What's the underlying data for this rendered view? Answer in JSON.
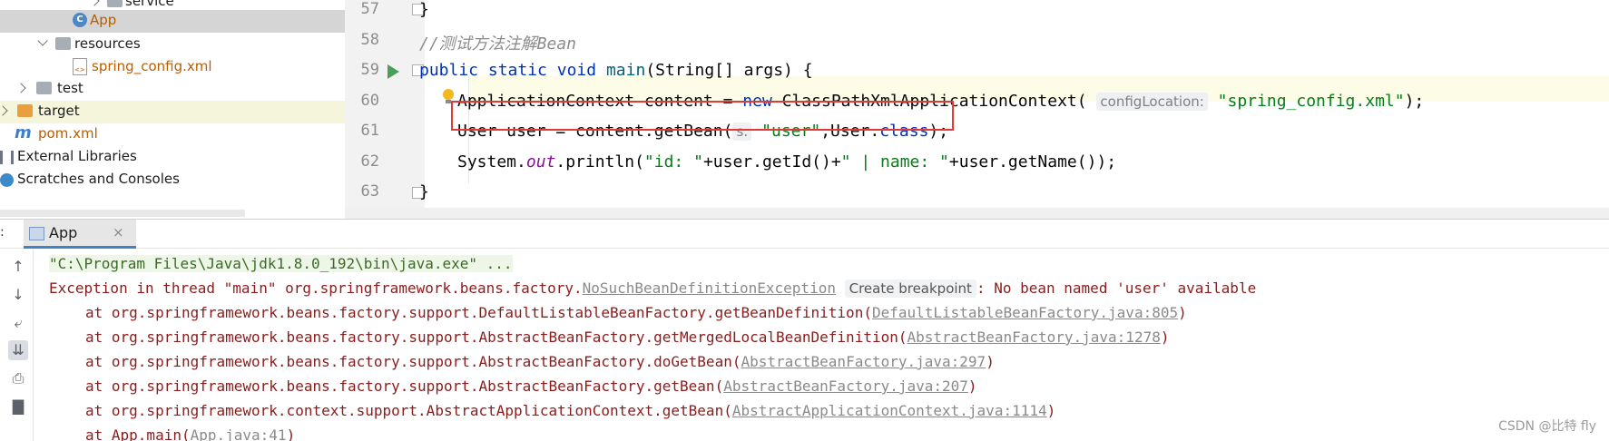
{
  "project_tree": {
    "items": [
      {
        "label": "service",
        "kind": "package"
      },
      {
        "label": "App",
        "kind": "class"
      },
      {
        "label": "resources",
        "kind": "folder"
      },
      {
        "label": "spring_config.xml",
        "kind": "xml"
      },
      {
        "label": "test",
        "kind": "folder"
      },
      {
        "label": "target",
        "kind": "folder"
      },
      {
        "label": "pom.xml",
        "kind": "maven"
      },
      {
        "label": "External Libraries",
        "kind": "libraries"
      },
      {
        "label": "Scratches and Consoles",
        "kind": "scratches"
      }
    ],
    "icon_letters": {
      "class": "C",
      "maven": "m",
      "xml": "<>"
    }
  },
  "editor": {
    "line_numbers": [
      "57",
      "58",
      "59",
      "60",
      "61",
      "62",
      "63"
    ],
    "lines": {
      "l57": "}",
      "l58": "//测试方法注解Bean",
      "l59": {
        "kw1": "public",
        "kw2": "static",
        "kw3": "void",
        "fn": "main",
        "rest": "(String[] args) {"
      },
      "l60": {
        "pre": "ApplicationContext content = ",
        "kw": "new",
        "cls": " ClassPathXmlApplicationContext(",
        "hint": "configLocation:",
        "str": "\"spring_config.xml\"",
        "post": ");"
      },
      "l61": {
        "pre": "User user = content.getBean(",
        "hint": "s:",
        "str": "\"user\"",
        "mid": ",User.",
        "kw": "class",
        "post": ");"
      },
      "l62": {
        "pre": "System.",
        "stat": "out",
        "mid": ".println(",
        "str1": "\"id: \"",
        "mid2": "+user.getId()+",
        "str2": "\" | name: \"",
        "post": "+user.getName());"
      },
      "l63": "}"
    }
  },
  "run_panel": {
    "prefix": ":",
    "tab_label": "App",
    "tab_close": "×",
    "console": {
      "cmd": "\"C:\\Program Files\\Java\\jdk1.8.0_192\\bin\\java.exe\" ...",
      "exception_pre": "Exception in thread \"main\" org.springframework.beans.factory.",
      "exception_link": "NoSuchBeanDefinitionException",
      "breakpoint_hint": "Create breakpoint",
      "exception_post": ": No bean named 'user' available",
      "stack": [
        {
          "pre": "at org.springframework.beans.factory.support.DefaultListableBeanFactory.getBeanDefinition(",
          "link": "DefaultListableBeanFactory.java:805",
          "post": ")"
        },
        {
          "pre": "at org.springframework.beans.factory.support.AbstractBeanFactory.getMergedLocalBeanDefinition(",
          "link": "AbstractBeanFactory.java:1278",
          "post": ")"
        },
        {
          "pre": "at org.springframework.beans.factory.support.AbstractBeanFactory.doGetBean(",
          "link": "AbstractBeanFactory.java:297",
          "post": ")"
        },
        {
          "pre": "at org.springframework.beans.factory.support.AbstractBeanFactory.getBean(",
          "link": "AbstractBeanFactory.java:207",
          "post": ")"
        },
        {
          "pre": "at org.springframework.context.support.AbstractApplicationContext.getBean(",
          "link": "AbstractApplicationContext.java:1114",
          "post": ")"
        },
        {
          "pre": "at App.main(",
          "link": "App.java:41",
          "post": ")"
        }
      ]
    },
    "toolbar_icons": [
      "arrow-up-icon",
      "arrow-down-icon",
      "soft-wrap-icon",
      "scroll-to-end-icon",
      "print-icon",
      "trash-icon"
    ]
  },
  "watermark": "CSDN @比特 fly",
  "colors": {
    "keyword": "#0033b3",
    "string": "#067d17",
    "comment": "#8c8c8c",
    "error": "#8b1c1c",
    "highlight_box": "#e03b3b",
    "run_arrow": "#4aa05a"
  }
}
